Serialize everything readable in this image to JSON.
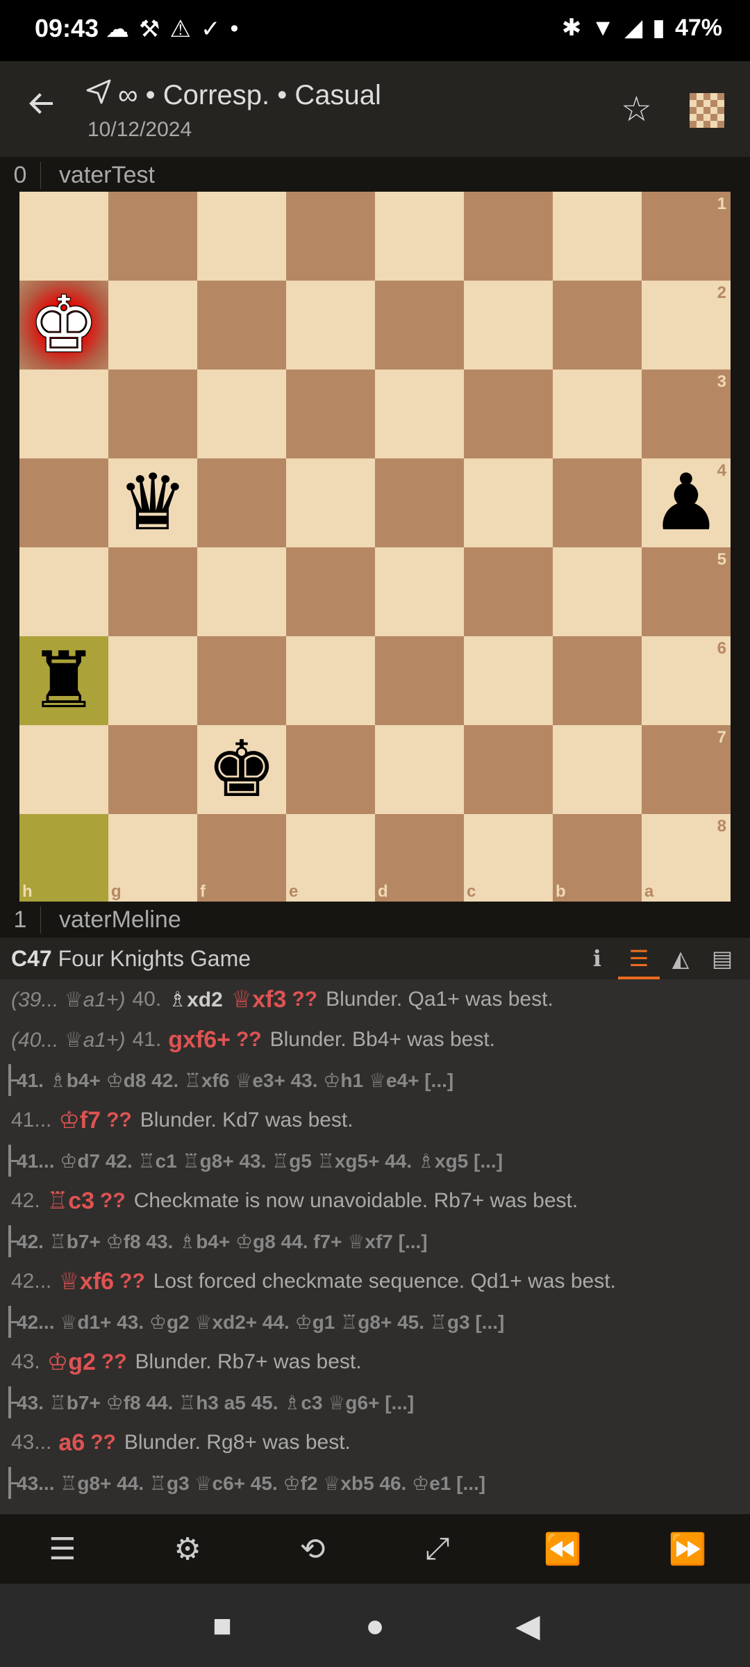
{
  "status": {
    "time": "09:43",
    "left_icons": [
      "☁",
      "⚒",
      "⚠",
      "✓",
      "•"
    ],
    "right_icons": [
      "✱",
      "▼",
      "◢",
      "▮"
    ],
    "battery": "47%"
  },
  "header": {
    "icon": "paper-plane-icon",
    "title": "∞ • Corresp. • Casual",
    "date": "10/12/2024"
  },
  "players": {
    "top": {
      "score": "0",
      "name": "vaterTest"
    },
    "bottom": {
      "score": "1",
      "name": "vaterMeline"
    }
  },
  "board": {
    "orientation": "black",
    "ranks": [
      "1",
      "2",
      "3",
      "4",
      "5",
      "6",
      "7",
      "8"
    ],
    "files": [
      "h",
      "g",
      "f",
      "e",
      "d",
      "c",
      "b",
      "a"
    ],
    "pieces": [
      {
        "square": "h2",
        "glyph": "♚",
        "color": "white",
        "name": "white-king-piece",
        "in_check": true
      },
      {
        "square": "g4",
        "glyph": "♛",
        "color": "black",
        "name": "black-queen-piece"
      },
      {
        "square": "a4",
        "glyph": "♟",
        "color": "black",
        "name": "black-pawn-piece"
      },
      {
        "square": "h6",
        "glyph": "♜",
        "color": "black",
        "name": "black-rook-piece"
      },
      {
        "square": "f7",
        "glyph": "♚",
        "color": "black",
        "name": "black-king-piece"
      }
    ],
    "last_move": [
      "h6",
      "h8"
    ],
    "colors": {
      "light": "#f0d9b5",
      "dark": "#b58863",
      "highlight": "#aba23a",
      "check": "#ff0000"
    }
  },
  "opening": {
    "eco": "C47",
    "name": "Four Knights Game"
  },
  "tabs": [
    "info-icon",
    "moves-icon",
    "chart-icon",
    "book-icon"
  ],
  "moves": [
    {
      "type": "main",
      "prefix": "(39... ♕a1+)",
      "num": "40.",
      "san": "♗xd2",
      "bad": "♕xf3",
      "glyph": "??",
      "comment": "Blunder. Qa1+ was best."
    },
    {
      "type": "main",
      "prefix": "(40... ♕a1+)",
      "num": "41.",
      "san": "",
      "bad": "gxf6+",
      "glyph": "??",
      "comment": "Blunder. Bb4+ was best."
    },
    {
      "type": "var",
      "text": "41. ♗b4+ ♔d8 42. ♖xf6 ♕e3+ 43. ♔h1 ♕e4+ [...]"
    },
    {
      "type": "main",
      "prefix": "",
      "num": "41...",
      "san": "",
      "bad": "♔f7",
      "glyph": "??",
      "comment": "Blunder. Kd7 was best."
    },
    {
      "type": "var",
      "text": "41... ♔d7 42. ♖c1 ♖g8+ 43. ♖g5 ♖xg5+ 44. ♗xg5 [...]"
    },
    {
      "type": "main",
      "prefix": "",
      "num": "42.",
      "san": "",
      "bad": "♖c3",
      "glyph": "??",
      "comment": "Checkmate is now unavoidable. Rb7+ was best."
    },
    {
      "type": "var",
      "text": "42. ♖b7+ ♔f8 43. ♗b4+ ♔g8 44. f7+ ♕xf7 [...]"
    },
    {
      "type": "main",
      "prefix": "",
      "num": "42...",
      "san": "",
      "bad": "♕xf6",
      "glyph": "??",
      "comment": "Lost forced checkmate sequence. Qd1+ was best."
    },
    {
      "type": "var",
      "text": "42... ♕d1+ 43. ♔g2 ♕xd2+ 44. ♔g1 ♖g8+ 45. ♖g3 [...]"
    },
    {
      "type": "main",
      "prefix": "",
      "num": "43.",
      "san": "",
      "bad": "♔g2",
      "glyph": "??",
      "comment": "Blunder. Rb7+ was best."
    },
    {
      "type": "var",
      "text": "43. ♖b7+ ♔f8 44. ♖h3 a5 45. ♗c3 ♕g6+ [...]"
    },
    {
      "type": "main",
      "prefix": "",
      "num": "43...",
      "san": "",
      "bad": "a6",
      "glyph": "??",
      "comment": "Blunder. Rg8+ was best."
    },
    {
      "type": "var",
      "text": "43... ♖g8+ 44. ♖g3 ♕c6+ 45. ♔f2 ♕xb5 46. ♔e1 [...]"
    }
  ],
  "toolbar": [
    {
      "name": "menu-icon",
      "glyph": "☰"
    },
    {
      "name": "settings-icon",
      "glyph": "⚙"
    },
    {
      "name": "flip-board-icon",
      "glyph": "⟲"
    },
    {
      "name": "expand-icon",
      "glyph": "⤢"
    },
    {
      "name": "previous-move-icon",
      "glyph": "⏪"
    },
    {
      "name": "next-move-icon",
      "glyph": "⏩"
    }
  ],
  "navbar": [
    {
      "name": "recents-button",
      "glyph": "■"
    },
    {
      "name": "home-button",
      "glyph": "●"
    },
    {
      "name": "back-nav-button",
      "glyph": "◀"
    }
  ]
}
